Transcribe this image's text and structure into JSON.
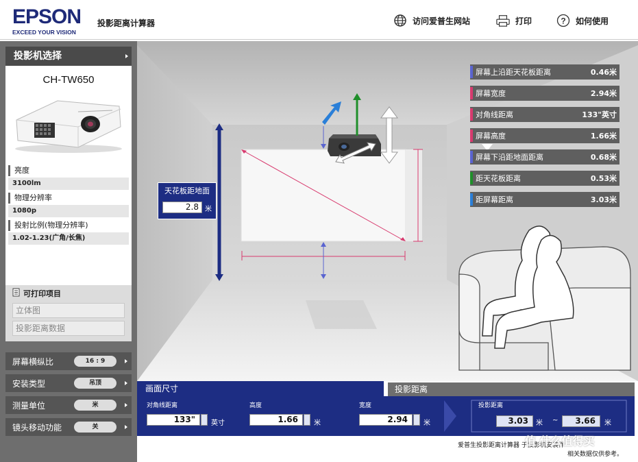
{
  "header": {
    "brand": "EPSON",
    "tagline": "EXCEED YOUR VISION",
    "app_title": "投影距离计算器",
    "links": [
      {
        "label": "访问爱普生网站",
        "icon": "globe-icon"
      },
      {
        "label": "打印",
        "icon": "printer-icon"
      },
      {
        "label": "如何使用",
        "icon": "help-icon"
      }
    ]
  },
  "sidebar": {
    "projector_select_label": "投影机选择",
    "model": "CH-TW650",
    "specs": [
      {
        "label": "亮度",
        "value": "3100lm"
      },
      {
        "label": "物理分辨率",
        "value": "1080p"
      },
      {
        "label": "投射比例(物理分辨率)",
        "value": "1.02-1.23(广角/长焦)"
      }
    ],
    "print": {
      "title": "可打印项目",
      "items": [
        "立体图",
        "投影距离数据"
      ]
    },
    "options": [
      {
        "label": "屏幕横纵比",
        "value": "16 : 9"
      },
      {
        "label": "安装类型",
        "value": "吊顶"
      },
      {
        "label": "测量单位",
        "value": "米"
      },
      {
        "label": "镜头移动功能",
        "value": "关"
      }
    ]
  },
  "scene": {
    "ceiling_label": "天花板距地面",
    "ceiling_value": "2.8",
    "ceiling_unit": "米",
    "results": [
      {
        "label": "屏幕上沿距天花板距离",
        "value": "0.46米",
        "color": "#5a64d0"
      },
      {
        "label": "屏幕宽度",
        "value": "2.94米",
        "color": "#d83a6e"
      },
      {
        "label": "对角线距离",
        "value": "133\"英寸",
        "color": "#d83a6e"
      },
      {
        "label": "屏幕高度",
        "value": "1.66米",
        "color": "#d83a6e"
      },
      {
        "label": "屏幕下沿距地面距离",
        "value": "0.68米",
        "color": "#5a64d0"
      },
      {
        "label": "距天花板距离",
        "value": "0.53米",
        "color": "#1f8f2a"
      },
      {
        "label": "距屏幕距离",
        "value": "3.03米",
        "color": "#2a7fd8"
      }
    ]
  },
  "bottom": {
    "tab_screen": "画面尺寸",
    "tab_distance": "投影距离",
    "fields": [
      {
        "label": "对角线距离",
        "value": "133\"",
        "unit": "英寸"
      },
      {
        "label": "高度",
        "value": "1.66",
        "unit": "米"
      },
      {
        "label": "宽度",
        "value": "2.94",
        "unit": "米"
      }
    ],
    "distance": {
      "label": "投影距离",
      "min": "3.03",
      "max": "3.66",
      "unit": "米",
      "sep": "~"
    },
    "note_line1": "爱普生投影距离计算器    于投影机安装作",
    "note_line2": "相关数据仅供参考。",
    "watermark": "值 什么值得买"
  }
}
